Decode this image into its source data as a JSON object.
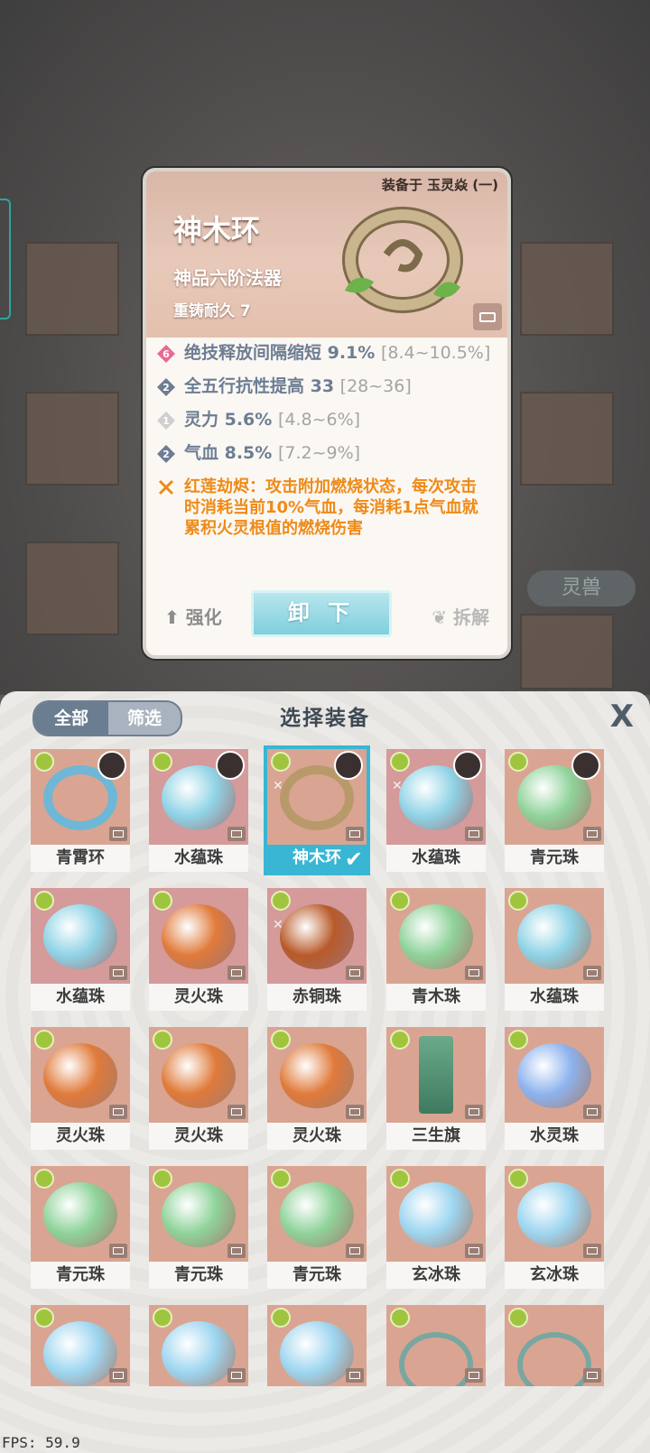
{
  "background": {
    "side_button": "灵兽"
  },
  "tooltip": {
    "equipped_on": "装备于 玉灵焱 (一)",
    "name": "神木环",
    "rank": "神品六阶法器",
    "durability": "重铸耐久 7",
    "stats": [
      {
        "text": "绝技释放间隔缩短 9.1% ",
        "range": "[8.4~10.5%]",
        "badge": "6",
        "badge_color": "#e86a94"
      },
      {
        "text": "全五行抗性提高 33 ",
        "range": "[28~36]",
        "badge": "2",
        "badge_color": "#6d7d94"
      },
      {
        "text": "灵力 5.6% ",
        "range": "[4.8~6%]",
        "badge": "1",
        "badge_color": "#c8c8c8"
      },
      {
        "text": "气血 8.5% ",
        "range": "[7.2~9%]",
        "badge": "2",
        "badge_color": "#6d7d94"
      }
    ],
    "effect": "红莲劫烬：攻击附加燃烧状态，每次攻击时消耗当前10%气血，每消耗1点气血就累积火灵根值的燃烧伤害",
    "btn_enhance": "强化",
    "btn_unequip": "卸 下",
    "btn_dismantle": "拆解"
  },
  "panel": {
    "tab_all": "全部",
    "tab_filter": "筛选",
    "title": "选择装备",
    "close": "X"
  },
  "items": [
    {
      "name": "青霄环",
      "kind": "ring-blue",
      "avatar": true
    },
    {
      "name": "水蕴珠",
      "kind": "pearl-blue",
      "avatar": true,
      "rose": true
    },
    {
      "name": "神木环",
      "kind": "ring-wood",
      "avatar": true,
      "selected": true,
      "lock": true
    },
    {
      "name": "水蕴珠",
      "kind": "pearl-blue",
      "avatar": true,
      "rose": true,
      "lock": true
    },
    {
      "name": "青元珠",
      "kind": "pearl-green",
      "avatar": true
    },
    {
      "name": "水蕴珠",
      "kind": "pearl-blue",
      "rose": true
    },
    {
      "name": "灵火珠",
      "kind": "pearl-fire",
      "rose": true
    },
    {
      "name": "赤铜珠",
      "kind": "pearl-copper",
      "rose": true,
      "lock": true
    },
    {
      "name": "青木珠",
      "kind": "pearl-green"
    },
    {
      "name": "水蕴珠",
      "kind": "pearl-blue"
    },
    {
      "name": "灵火珠",
      "kind": "pearl-fire"
    },
    {
      "name": "灵火珠",
      "kind": "pearl-fire"
    },
    {
      "name": "灵火珠",
      "kind": "pearl-fire"
    },
    {
      "name": "三生旗",
      "kind": "banner"
    },
    {
      "name": "水灵珠",
      "kind": "pearl-purple"
    },
    {
      "name": "青元珠",
      "kind": "pearl-green"
    },
    {
      "name": "青元珠",
      "kind": "pearl-green"
    },
    {
      "name": "青元珠",
      "kind": "pearl-green"
    },
    {
      "name": "玄冰珠",
      "kind": "pearl-ice"
    },
    {
      "name": "玄冰珠",
      "kind": "pearl-ice"
    },
    {
      "name": "",
      "kind": "pearl-ice"
    },
    {
      "name": "",
      "kind": "pearl-ice"
    },
    {
      "name": "",
      "kind": "pearl-ice"
    },
    {
      "name": "",
      "kind": "vine"
    },
    {
      "name": "",
      "kind": "vine"
    }
  ],
  "colors": {
    "pearl-blue": "#8fd3e6",
    "pearl-green": "#8fd39a",
    "pearl-fire": "#e07a3a",
    "pearl-copper": "#b85a2a",
    "pearl-purple": "#8db3ee",
    "pearl-ice": "#9ed6f0",
    "ring-blue": "#6fb7d6",
    "ring-wood": "#b89a6a",
    "banner": "#6aaa8a",
    "vine": "#7aa6a0"
  },
  "fps": "FPS: 59.9"
}
